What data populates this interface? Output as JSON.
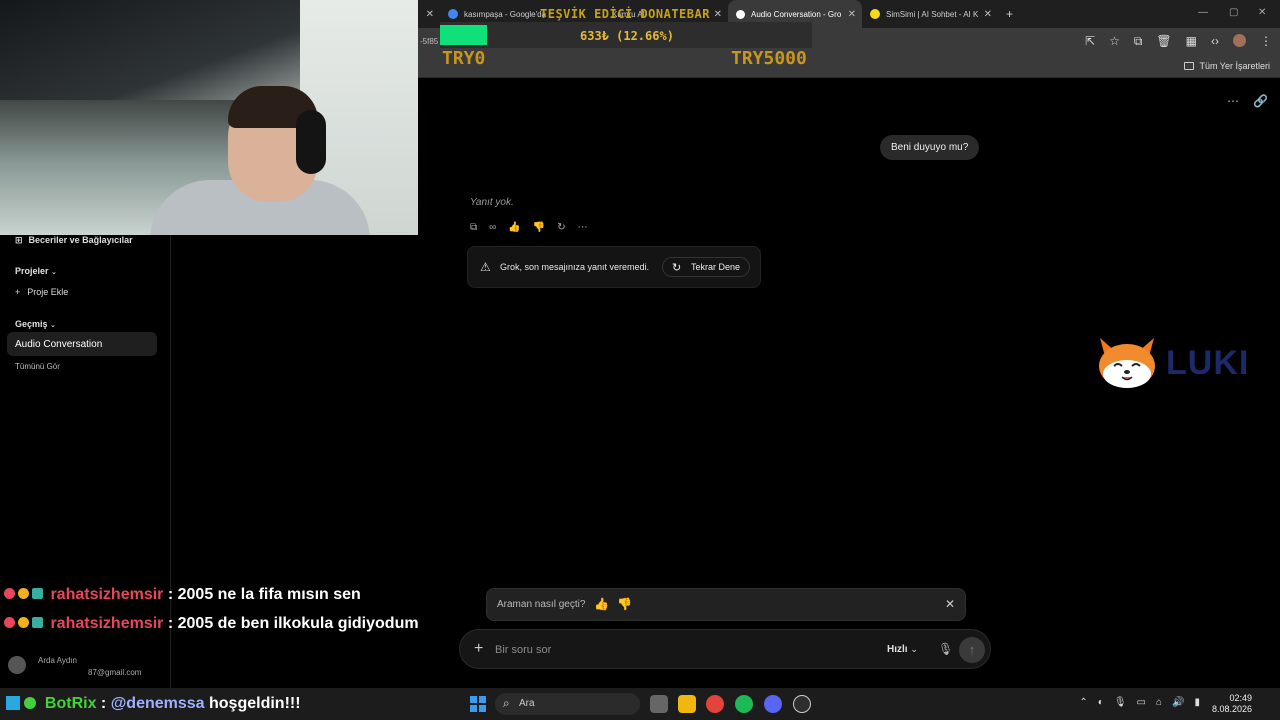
{
  "browser": {
    "tabs": [
      {
        "title": "kasımpaşa - Google'da",
        "active": false
      },
      {
        "title": "Kumru AI",
        "active": false
      },
      {
        "title": "Audio Conversation - Gro",
        "active": true
      },
      {
        "title": "SimSimi | AI Sohbet - AI K",
        "active": false
      }
    ],
    "new_tab": "+",
    "address_fragment": "-5f85",
    "bookmarks_all": "Tüm Yer İşaretleri"
  },
  "donate_bar": {
    "title": "TEŞVİK EDİCİ DONATEBAR",
    "amount": "633₺ (12.66%)",
    "progress_fraction": 0.1266,
    "min": "TRY0",
    "max": "TRY5000",
    "colors": {
      "fill": "#10e07a",
      "text": "#c8961c"
    }
  },
  "sidebar": {
    "skills": "Beceriler ve Bağlayıcılar",
    "projects_header": "Projeler",
    "add_project": "Proje Ekle",
    "history_header": "Geçmiş",
    "active_conversation": "Audio Conversation",
    "see_all": "Tümünü Gör",
    "user_name": "Arda Aydın",
    "user_email": "87@gmail.com"
  },
  "chat": {
    "user_message": "Beni duyuyo mu?",
    "no_reply": "Yanıt yok.",
    "error_message": "Grok, son mesajınıza yanıt veremedi.",
    "retry_label": "Tekrar Dene",
    "feedback_question": "Araman nasıl geçti?",
    "input_placeholder": "Bir soru sor",
    "mode_label": "Hızlı"
  },
  "overlay_logo": "LUKI",
  "stream_chat": [
    {
      "user": "rahatsizhemsir",
      "text": ": 2005 ne la fifa mısın sen"
    },
    {
      "user": "rahatsizhemsir",
      "text": ": 2005 de ben ilkokula gidiyodum"
    }
  ],
  "bot_message": {
    "bot": "BotRix",
    "sep": " : ",
    "mention": "@denemssa",
    "text": " hoşgeldin!!!"
  },
  "taskbar": {
    "search_placeholder": "Ara",
    "time": "02:49",
    "date": "8.08.2026"
  }
}
